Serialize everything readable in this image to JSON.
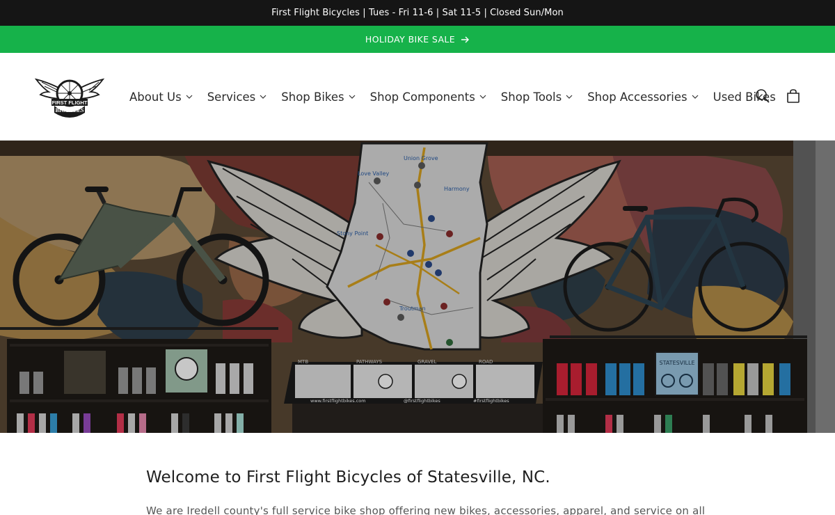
{
  "announcement": {
    "text": "First Flight Bicycles | Tues - Fri 11-6 | Sat 11-5 | Closed Sun/Mon",
    "background": "#151515"
  },
  "sale_banner": {
    "label": "HOLIDAY BIKE SALE",
    "icon": "arrow-right-icon",
    "background": "#16b24a"
  },
  "header": {
    "logo": {
      "top_text": "FIRST FLIGHT",
      "bottom_text": "BICYCLES",
      "icon": "winged-wheel-logo"
    },
    "nav": [
      {
        "label": "About Us",
        "has_dropdown": true
      },
      {
        "label": "Services",
        "has_dropdown": true
      },
      {
        "label": "Shop Bikes",
        "has_dropdown": true
      },
      {
        "label": "Shop Components",
        "has_dropdown": true
      },
      {
        "label": "Shop Tools",
        "has_dropdown": true
      },
      {
        "label": "Shop Accessories",
        "has_dropdown": true
      },
      {
        "label": "Used Bikes",
        "has_dropdown": false
      }
    ],
    "icons": [
      "search-icon",
      "cart-icon"
    ]
  },
  "hero": {
    "map_labels": [
      "Union Grove",
      "Love Valley",
      "Harmony",
      "Stony Point",
      "Troutman"
    ],
    "kiosk_tabs": [
      "MTB",
      "PATHWAYS",
      "GRAVEL",
      "ROAD"
    ],
    "kiosk_footer": [
      "www.firstflightbikes.com",
      "@firstflightbikes",
      "#firstflightbikes"
    ],
    "poster_text": "STATESVILLE"
  },
  "main": {
    "title": "Welcome to First Flight Bicycles of Statesville, NC.",
    "intro": "We are Iredell county's full service bike shop offering new bikes, accessories, apparel, and service on all"
  }
}
